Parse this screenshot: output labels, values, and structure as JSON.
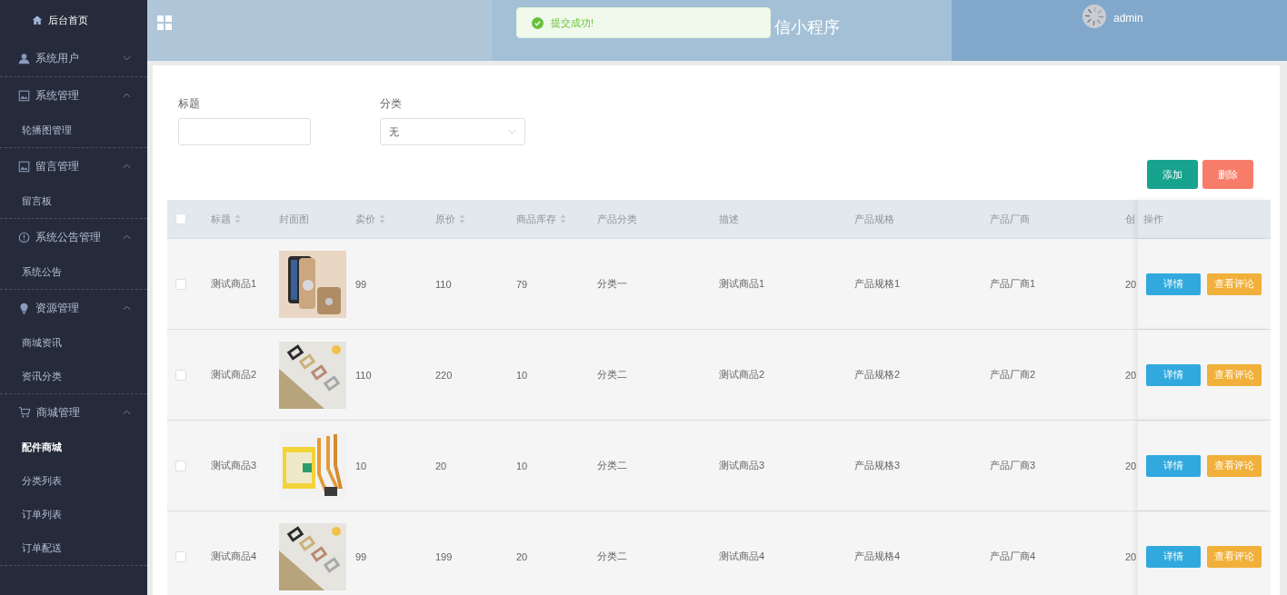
{
  "sidebar": {
    "home": "后台首页",
    "groups": [
      {
        "label": "系统用户",
        "expanded": false
      },
      {
        "label": "系统管理",
        "expanded": true,
        "items": [
          {
            "label": "轮播图管理",
            "selected": false
          }
        ]
      },
      {
        "label": "留言管理",
        "expanded": true,
        "items": [
          {
            "label": "留言板",
            "selected": false
          }
        ]
      },
      {
        "label": "系统公告管理",
        "expanded": true,
        "items": [
          {
            "label": "系统公告",
            "selected": false
          }
        ]
      },
      {
        "label": "资源管理",
        "expanded": true,
        "items": [
          {
            "label": "商城资讯",
            "selected": false
          },
          {
            "label": "资讯分类",
            "selected": false
          }
        ]
      },
      {
        "label": "商城管理",
        "expanded": true,
        "items": [
          {
            "label": "配件商城",
            "selected": true
          },
          {
            "label": "分类列表",
            "selected": false
          },
          {
            "label": "订单列表",
            "selected": false
          },
          {
            "label": "订单配送",
            "selected": false
          }
        ]
      }
    ]
  },
  "header": {
    "title": "信小程序",
    "user": "admin"
  },
  "toast": {
    "message": "提交成功!"
  },
  "filters": [
    {
      "label": "标题",
      "kind": "input"
    },
    {
      "label": "分类",
      "kind": "select",
      "value": "无"
    }
  ],
  "actions": [
    {
      "label": "添加",
      "kind": "add"
    },
    {
      "label": "删除",
      "kind": "delete"
    }
  ],
  "table": {
    "select_all": {
      "checked": false
    },
    "columns": [
      {
        "label": "标题",
        "sortable": true
      },
      {
        "label": "封面图",
        "sortable": false
      },
      {
        "label": "卖价",
        "sortable": true
      },
      {
        "label": "原价",
        "sortable": true
      },
      {
        "label": "商品库存",
        "sortable": true
      },
      {
        "label": "产品分类",
        "sortable": false
      },
      {
        "label": "描述",
        "sortable": false
      },
      {
        "label": "产品规格",
        "sortable": false
      },
      {
        "label": "产品厂商",
        "sortable": false
      },
      {
        "label": "创",
        "sortable": false
      },
      {
        "label": "操作",
        "sortable": false
      }
    ],
    "rows": [
      {
        "checked": false,
        "title": "测试商品1",
        "price": "99",
        "original_price": "110",
        "stock": "79",
        "category": "分类一",
        "description": "测试商品1",
        "spec": "产品规格1",
        "maker": "产品厂商1",
        "column_11": "20",
        "buttons": [
          "详情",
          "查看评论"
        ]
      },
      {
        "checked": false,
        "title": "测试商品2",
        "price": "110",
        "original_price": "220",
        "stock": "10",
        "category": "分类二",
        "description": "测试商品2",
        "spec": "产品规格2",
        "maker": "产品厂商2",
        "column_11": "20",
        "buttons": [
          "详情",
          "查看评论"
        ]
      },
      {
        "checked": false,
        "title": "测试商品3",
        "price": "10",
        "original_price": "20",
        "stock": "10",
        "category": "分类二",
        "description": "测试商品3",
        "spec": "产品规格3",
        "maker": "产品厂商3",
        "column_11": "20",
        "buttons": [
          "详情",
          "查看评论"
        ]
      },
      {
        "checked": false,
        "title": "测试商品4",
        "price": "99",
        "original_price": "199",
        "stock": "20",
        "category": "分类二",
        "description": "测试商品4",
        "spec": "产品规格4",
        "maker": "产品厂商4",
        "column_11": "20",
        "buttons": [
          "详情",
          "查看评论"
        ]
      }
    ]
  }
}
